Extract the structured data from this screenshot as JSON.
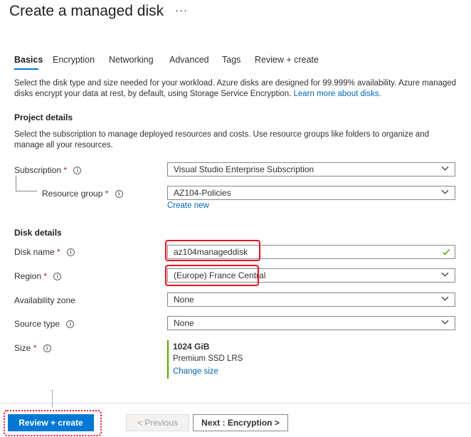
{
  "header": {
    "title": "Create a managed disk",
    "more_label": "···"
  },
  "tabs": [
    {
      "label": "Basics",
      "active": true
    },
    {
      "label": "Encryption"
    },
    {
      "label": "Networking"
    },
    {
      "label": "Advanced"
    },
    {
      "label": "Tags"
    },
    {
      "label": "Review + create"
    }
  ],
  "intro": {
    "text": "Select the disk type and size needed for your workload. Azure disks are designed for 99.999% availability. Azure managed disks encrypt your data at rest, by default, using Storage Service Encryption.",
    "link": "Learn more about disks."
  },
  "project": {
    "heading": "Project details",
    "description": "Select the subscription to manage deployed resources and costs. Use resource groups like folders to organize and manage all your resources.",
    "subscription_label": "Subscription",
    "subscription_value": "Visual Studio Enterprise Subscription",
    "resource_group_label": "Resource group",
    "resource_group_value": "AZ104-Policies",
    "create_new": "Create new"
  },
  "disk": {
    "heading": "Disk details",
    "name_label": "Disk name",
    "name_value": "az104manageddisk",
    "region_label": "Region",
    "region_value": "(Europe) France Central",
    "zone_label": "Availability zone",
    "zone_value": "None",
    "source_label": "Source type",
    "source_value": "None",
    "size_label": "Size",
    "size_value": "1024 GiB",
    "size_sku": "Premium SSD LRS",
    "change_size": "Change size"
  },
  "required_marker": "*",
  "info_glyph": "i",
  "footer": {
    "review_create": "Review + create",
    "previous": "< Previous",
    "next": "Next : Encryption >"
  },
  "colors": {
    "accent": "#0078d4",
    "link": "#0067b8",
    "highlight": "#e81123",
    "success": "#57a300",
    "required": "#a4262c"
  },
  "icons": {
    "dropdown": "chevron-down-icon",
    "valid": "checkmark-icon",
    "info": "info-icon"
  }
}
